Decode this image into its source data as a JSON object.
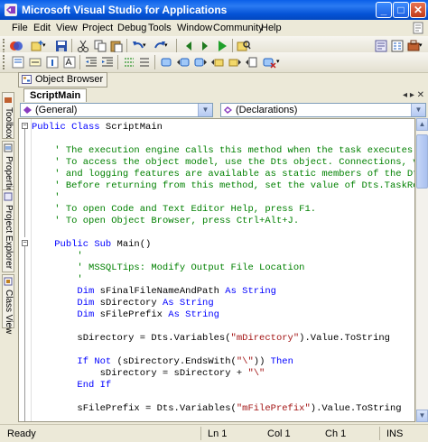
{
  "window": {
    "title": "Microsoft Visual Studio for Applications",
    "minimize_glyph": "_",
    "maximize_glyph": "□",
    "close_glyph": "✕"
  },
  "menu": [
    "File",
    "Edit",
    "View",
    "Project",
    "Debug",
    "Tools",
    "Window",
    "Community",
    "Help"
  ],
  "object_browser_tab": "Object Browser",
  "side_tabs": [
    "Toolbox",
    "Properties",
    "Project Explorer",
    "Class View"
  ],
  "document": {
    "tab": "ScriptMain",
    "controls": "◂ ▸ ✕"
  },
  "combos": {
    "left": "(General)",
    "right": "(Declarations)"
  },
  "code_lines": [
    [
      {
        "t": "k",
        "v": "Public Class "
      },
      {
        "t": "n",
        "v": "ScriptMain"
      }
    ],
    [],
    [
      {
        "t": "n",
        "v": "    "
      },
      {
        "t": "c",
        "v": "' The execution engine calls this method when the task executes."
      }
    ],
    [
      {
        "t": "n",
        "v": "    "
      },
      {
        "t": "c",
        "v": "' To access the object model, use the Dts object. Connections, v"
      }
    ],
    [
      {
        "t": "n",
        "v": "    "
      },
      {
        "t": "c",
        "v": "' and logging features are available as static members of the Dt"
      }
    ],
    [
      {
        "t": "n",
        "v": "    "
      },
      {
        "t": "c",
        "v": "' Before returning from this method, set the value of Dts.TaskRe"
      }
    ],
    [
      {
        "t": "n",
        "v": "    "
      },
      {
        "t": "c",
        "v": "'"
      }
    ],
    [
      {
        "t": "n",
        "v": "    "
      },
      {
        "t": "c",
        "v": "' To open Code and Text Editor Help, press F1."
      }
    ],
    [
      {
        "t": "n",
        "v": "    "
      },
      {
        "t": "c",
        "v": "' To open Object Browser, press Ctrl+Alt+J."
      }
    ],
    [],
    [
      {
        "t": "n",
        "v": "    "
      },
      {
        "t": "k",
        "v": "Public Sub "
      },
      {
        "t": "n",
        "v": "Main()"
      }
    ],
    [
      {
        "t": "n",
        "v": "        "
      },
      {
        "t": "c",
        "v": "'"
      }
    ],
    [
      {
        "t": "n",
        "v": "        "
      },
      {
        "t": "c",
        "v": "' MSSQLTips: Modify Output File Location"
      }
    ],
    [
      {
        "t": "n",
        "v": "        "
      },
      {
        "t": "c",
        "v": "'"
      }
    ],
    [
      {
        "t": "n",
        "v": "        "
      },
      {
        "t": "k",
        "v": "Dim "
      },
      {
        "t": "n",
        "v": "sFinalFileNameAndPath "
      },
      {
        "t": "k",
        "v": "As String"
      }
    ],
    [
      {
        "t": "n",
        "v": "        "
      },
      {
        "t": "k",
        "v": "Dim "
      },
      {
        "t": "n",
        "v": "sDirectory "
      },
      {
        "t": "k",
        "v": "As String"
      }
    ],
    [
      {
        "t": "n",
        "v": "        "
      },
      {
        "t": "k",
        "v": "Dim "
      },
      {
        "t": "n",
        "v": "sFilePrefix "
      },
      {
        "t": "k",
        "v": "As String"
      }
    ],
    [],
    [
      {
        "t": "n",
        "v": "        sDirectory = Dts.Variables("
      },
      {
        "t": "s",
        "v": "\"mDirectory\""
      },
      {
        "t": "n",
        "v": ").Value.ToString"
      }
    ],
    [],
    [
      {
        "t": "n",
        "v": "        "
      },
      {
        "t": "k",
        "v": "If Not "
      },
      {
        "t": "n",
        "v": "(sDirectory.EndsWith("
      },
      {
        "t": "s",
        "v": "\"\\\""
      },
      {
        "t": "n",
        "v": ")) "
      },
      {
        "t": "k",
        "v": "Then"
      }
    ],
    [
      {
        "t": "n",
        "v": "            sDirectory = sDirectory + "
      },
      {
        "t": "s",
        "v": "\"\\\""
      }
    ],
    [
      {
        "t": "n",
        "v": "        "
      },
      {
        "t": "k",
        "v": "End If"
      }
    ],
    [],
    [
      {
        "t": "n",
        "v": "        sFilePrefix = Dts.Variables("
      },
      {
        "t": "s",
        "v": "\"mFilePrefix\""
      },
      {
        "t": "n",
        "v": ").Value.ToString"
      }
    ]
  ],
  "status": {
    "ready": "Ready",
    "line": "Ln 1",
    "col": "Col 1",
    "ch": "Ch 1",
    "ins": "INS"
  },
  "colors": {
    "keyword": "#0000FF",
    "comment": "#008000",
    "string": "#A31515",
    "titlebar": "#0A5FE8"
  }
}
